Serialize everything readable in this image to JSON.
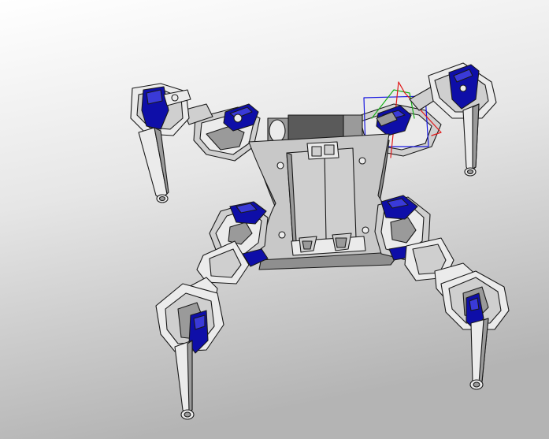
{
  "scene": {
    "subject": "hexapod-robot-cad-model",
    "background": {
      "gradient_top": "#ffffff",
      "gradient_mid": "#e6e6e6",
      "gradient_bottom": "#b4b4b4"
    },
    "colors": {
      "plate": "#c8c8c8",
      "plate_side": "#8f8f8f",
      "part_light": "#ebebeb",
      "part_mid": "#cfcfcf",
      "part_dark": "#9a9a9a",
      "servo": "#0e0ea8",
      "servo_light": "#3a3ad8",
      "outline": "#1a1a1a",
      "spine": "#5a5a5a",
      "gizmo_x": "#e01818",
      "gizmo_y": "#18b018",
      "gizmo_z": "#1818e0"
    },
    "legs": [
      "front-left",
      "front-right",
      "rear-left",
      "rear-right"
    ]
  }
}
